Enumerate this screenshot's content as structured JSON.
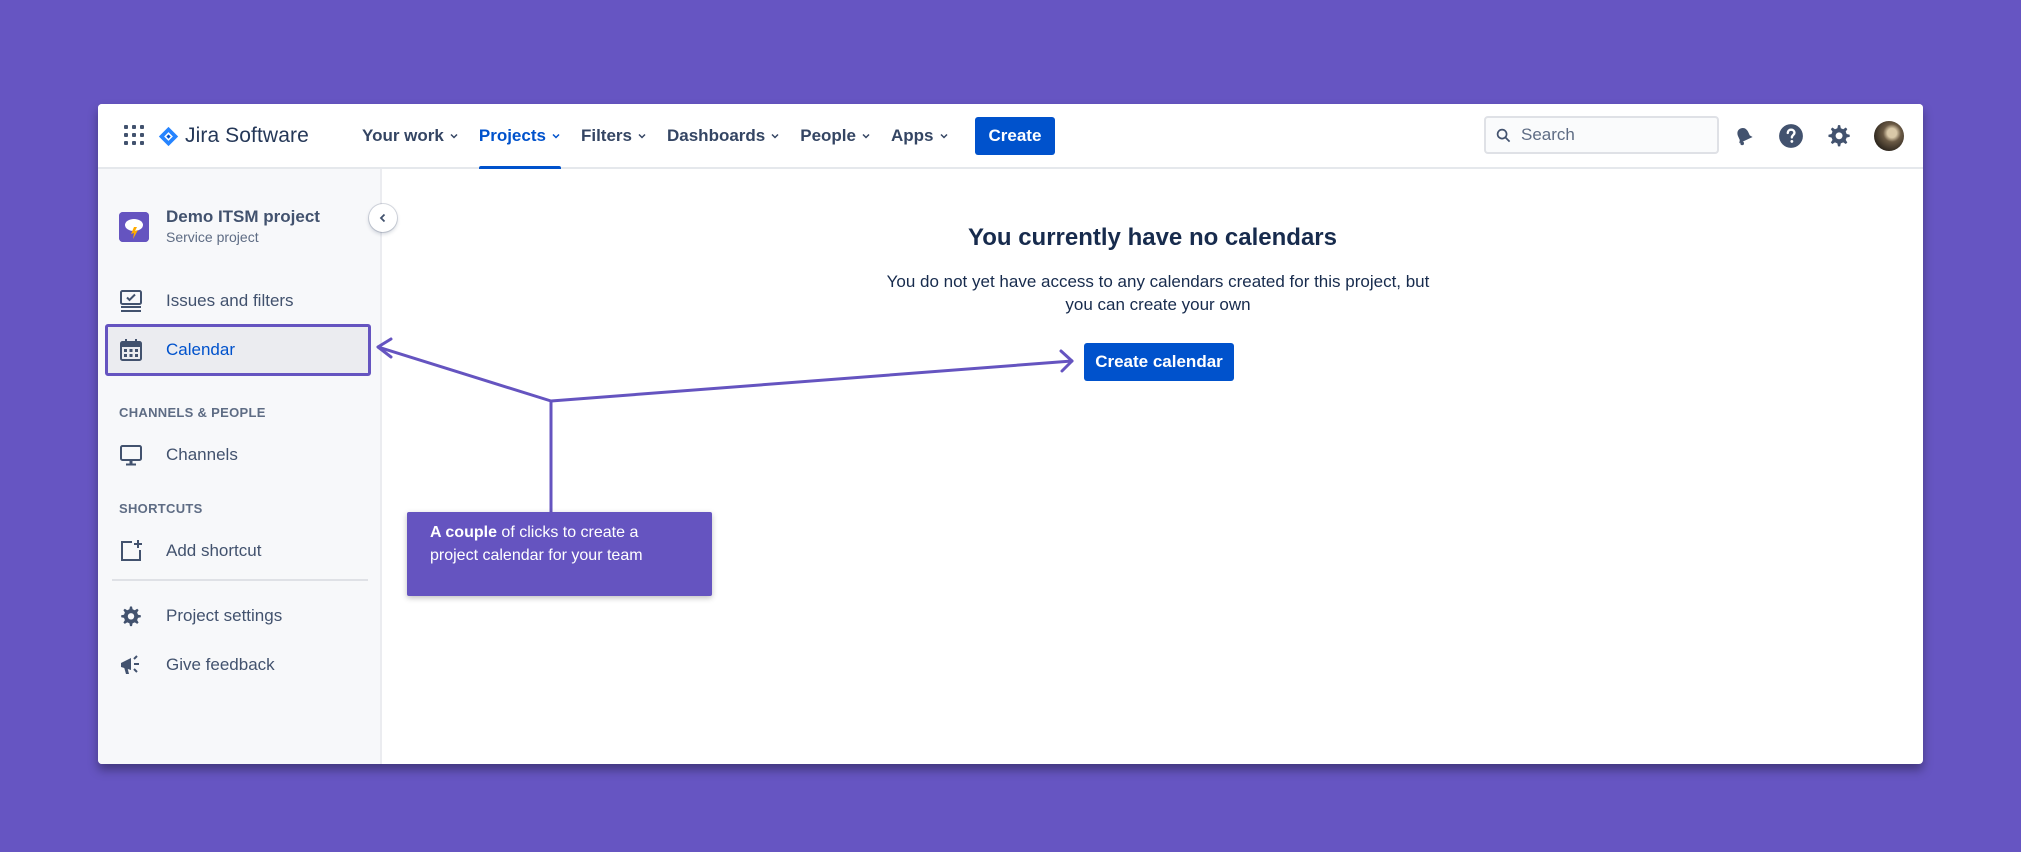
{
  "brand": {
    "name": "Jira Software"
  },
  "nav": {
    "items": [
      {
        "label": "Your work"
      },
      {
        "label": "Projects"
      },
      {
        "label": "Filters"
      },
      {
        "label": "Dashboards"
      },
      {
        "label": "People"
      },
      {
        "label": "Apps"
      }
    ],
    "active": "Projects",
    "create_label": "Create"
  },
  "search": {
    "placeholder": "Search"
  },
  "sidebar": {
    "project_name": "Demo ITSM project",
    "project_type": "Service project",
    "items": [
      {
        "label": "Issues and filters",
        "icon": "issues-icon"
      },
      {
        "label": "Calendar",
        "icon": "calendar-icon"
      }
    ],
    "channels_heading": "CHANNELS & PEOPLE",
    "channels_label": "Channels",
    "shortcuts_heading": "SHORTCUTS",
    "add_shortcut_label": "Add shortcut",
    "settings_label": "Project settings",
    "feedback_label": "Give feedback"
  },
  "main": {
    "title": "You currently have no calendars",
    "description": "You do not yet have access to any calendars created for this project, but you can create your own",
    "create_calendar_label": "Create calendar"
  },
  "callout": {
    "bold": "A couple",
    "text": " of clicks to create a project calendar for your team"
  },
  "colors": {
    "background": "#6655C2",
    "accent": "#0052CC",
    "annotation": "#6554C0"
  }
}
